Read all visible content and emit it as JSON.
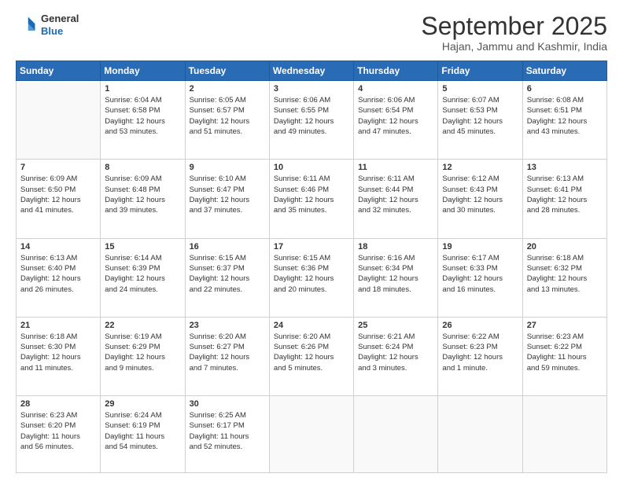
{
  "header": {
    "logo_general": "General",
    "logo_blue": "Blue",
    "month_title": "September 2025",
    "location": "Hajan, Jammu and Kashmir, India"
  },
  "days_header": [
    "Sunday",
    "Monday",
    "Tuesday",
    "Wednesday",
    "Thursday",
    "Friday",
    "Saturday"
  ],
  "weeks": [
    [
      {
        "num": "",
        "lines": []
      },
      {
        "num": "1",
        "lines": [
          "Sunrise: 6:04 AM",
          "Sunset: 6:58 PM",
          "Daylight: 12 hours",
          "and 53 minutes."
        ]
      },
      {
        "num": "2",
        "lines": [
          "Sunrise: 6:05 AM",
          "Sunset: 6:57 PM",
          "Daylight: 12 hours",
          "and 51 minutes."
        ]
      },
      {
        "num": "3",
        "lines": [
          "Sunrise: 6:06 AM",
          "Sunset: 6:55 PM",
          "Daylight: 12 hours",
          "and 49 minutes."
        ]
      },
      {
        "num": "4",
        "lines": [
          "Sunrise: 6:06 AM",
          "Sunset: 6:54 PM",
          "Daylight: 12 hours",
          "and 47 minutes."
        ]
      },
      {
        "num": "5",
        "lines": [
          "Sunrise: 6:07 AM",
          "Sunset: 6:53 PM",
          "Daylight: 12 hours",
          "and 45 minutes."
        ]
      },
      {
        "num": "6",
        "lines": [
          "Sunrise: 6:08 AM",
          "Sunset: 6:51 PM",
          "Daylight: 12 hours",
          "and 43 minutes."
        ]
      }
    ],
    [
      {
        "num": "7",
        "lines": [
          "Sunrise: 6:09 AM",
          "Sunset: 6:50 PM",
          "Daylight: 12 hours",
          "and 41 minutes."
        ]
      },
      {
        "num": "8",
        "lines": [
          "Sunrise: 6:09 AM",
          "Sunset: 6:48 PM",
          "Daylight: 12 hours",
          "and 39 minutes."
        ]
      },
      {
        "num": "9",
        "lines": [
          "Sunrise: 6:10 AM",
          "Sunset: 6:47 PM",
          "Daylight: 12 hours",
          "and 37 minutes."
        ]
      },
      {
        "num": "10",
        "lines": [
          "Sunrise: 6:11 AM",
          "Sunset: 6:46 PM",
          "Daylight: 12 hours",
          "and 35 minutes."
        ]
      },
      {
        "num": "11",
        "lines": [
          "Sunrise: 6:11 AM",
          "Sunset: 6:44 PM",
          "Daylight: 12 hours",
          "and 32 minutes."
        ]
      },
      {
        "num": "12",
        "lines": [
          "Sunrise: 6:12 AM",
          "Sunset: 6:43 PM",
          "Daylight: 12 hours",
          "and 30 minutes."
        ]
      },
      {
        "num": "13",
        "lines": [
          "Sunrise: 6:13 AM",
          "Sunset: 6:41 PM",
          "Daylight: 12 hours",
          "and 28 minutes."
        ]
      }
    ],
    [
      {
        "num": "14",
        "lines": [
          "Sunrise: 6:13 AM",
          "Sunset: 6:40 PM",
          "Daylight: 12 hours",
          "and 26 minutes."
        ]
      },
      {
        "num": "15",
        "lines": [
          "Sunrise: 6:14 AM",
          "Sunset: 6:39 PM",
          "Daylight: 12 hours",
          "and 24 minutes."
        ]
      },
      {
        "num": "16",
        "lines": [
          "Sunrise: 6:15 AM",
          "Sunset: 6:37 PM",
          "Daylight: 12 hours",
          "and 22 minutes."
        ]
      },
      {
        "num": "17",
        "lines": [
          "Sunrise: 6:15 AM",
          "Sunset: 6:36 PM",
          "Daylight: 12 hours",
          "and 20 minutes."
        ]
      },
      {
        "num": "18",
        "lines": [
          "Sunrise: 6:16 AM",
          "Sunset: 6:34 PM",
          "Daylight: 12 hours",
          "and 18 minutes."
        ]
      },
      {
        "num": "19",
        "lines": [
          "Sunrise: 6:17 AM",
          "Sunset: 6:33 PM",
          "Daylight: 12 hours",
          "and 16 minutes."
        ]
      },
      {
        "num": "20",
        "lines": [
          "Sunrise: 6:18 AM",
          "Sunset: 6:32 PM",
          "Daylight: 12 hours",
          "and 13 minutes."
        ]
      }
    ],
    [
      {
        "num": "21",
        "lines": [
          "Sunrise: 6:18 AM",
          "Sunset: 6:30 PM",
          "Daylight: 12 hours",
          "and 11 minutes."
        ]
      },
      {
        "num": "22",
        "lines": [
          "Sunrise: 6:19 AM",
          "Sunset: 6:29 PM",
          "Daylight: 12 hours",
          "and 9 minutes."
        ]
      },
      {
        "num": "23",
        "lines": [
          "Sunrise: 6:20 AM",
          "Sunset: 6:27 PM",
          "Daylight: 12 hours",
          "and 7 minutes."
        ]
      },
      {
        "num": "24",
        "lines": [
          "Sunrise: 6:20 AM",
          "Sunset: 6:26 PM",
          "Daylight: 12 hours",
          "and 5 minutes."
        ]
      },
      {
        "num": "25",
        "lines": [
          "Sunrise: 6:21 AM",
          "Sunset: 6:24 PM",
          "Daylight: 12 hours",
          "and 3 minutes."
        ]
      },
      {
        "num": "26",
        "lines": [
          "Sunrise: 6:22 AM",
          "Sunset: 6:23 PM",
          "Daylight: 12 hours",
          "and 1 minute."
        ]
      },
      {
        "num": "27",
        "lines": [
          "Sunrise: 6:23 AM",
          "Sunset: 6:22 PM",
          "Daylight: 11 hours",
          "and 59 minutes."
        ]
      }
    ],
    [
      {
        "num": "28",
        "lines": [
          "Sunrise: 6:23 AM",
          "Sunset: 6:20 PM",
          "Daylight: 11 hours",
          "and 56 minutes."
        ]
      },
      {
        "num": "29",
        "lines": [
          "Sunrise: 6:24 AM",
          "Sunset: 6:19 PM",
          "Daylight: 11 hours",
          "and 54 minutes."
        ]
      },
      {
        "num": "30",
        "lines": [
          "Sunrise: 6:25 AM",
          "Sunset: 6:17 PM",
          "Daylight: 11 hours",
          "and 52 minutes."
        ]
      },
      {
        "num": "",
        "lines": []
      },
      {
        "num": "",
        "lines": []
      },
      {
        "num": "",
        "lines": []
      },
      {
        "num": "",
        "lines": []
      }
    ]
  ]
}
